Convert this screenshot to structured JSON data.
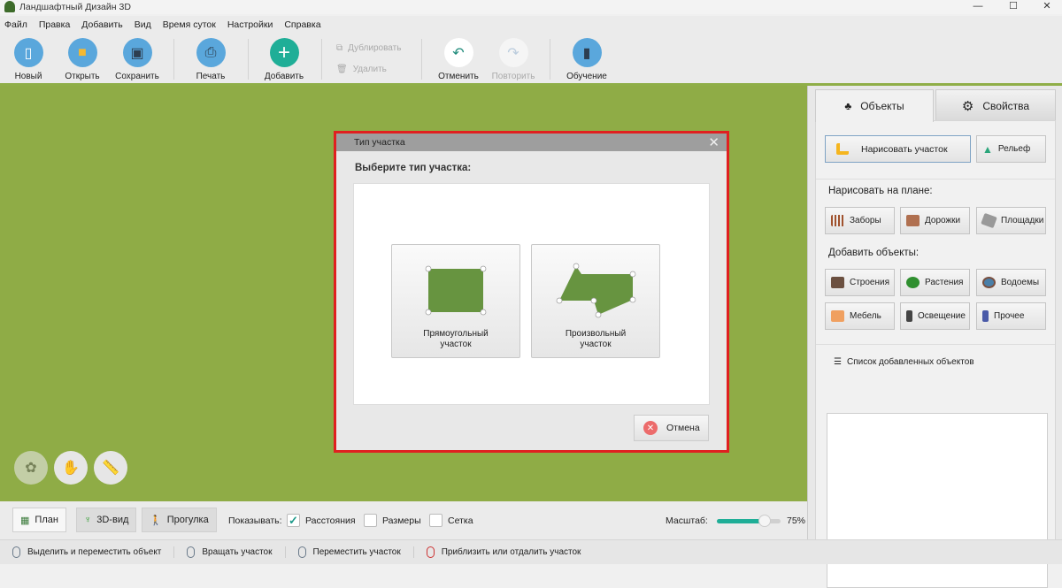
{
  "window": {
    "title": "Ландшафтный Дизайн 3D",
    "minimize": "—",
    "maximize": "☐",
    "close": "✕"
  },
  "menu": [
    "Файл",
    "Правка",
    "Добавить",
    "Вид",
    "Время суток",
    "Настройки",
    "Справка"
  ],
  "toolbar": {
    "new": "Новый",
    "open": "Открыть",
    "save": "Сохранить",
    "print": "Печать",
    "add": "Добавить",
    "duplicate": "Дублировать",
    "delete": "Удалить",
    "undo": "Отменить",
    "redo": "Повторить",
    "tutorial": "Обучение"
  },
  "dialog": {
    "title": "Тип участка",
    "prompt": "Выберите тип участка:",
    "rect_line1": "Прямоугольный",
    "rect_line2": "участок",
    "free_line1": "Произвольный",
    "free_line2": "участок",
    "cancel": "Отмена",
    "highlight_color": "#e02020"
  },
  "panel": {
    "tab_objects": "Объекты",
    "tab_properties": "Свойства",
    "draw_plot": "Нарисовать участок",
    "relief": "Рельеф",
    "draw_on_plan": "Нарисовать на плане:",
    "fences": "Заборы",
    "paths": "Дорожки",
    "areas": "Площадки",
    "add_objects": "Добавить объекты:",
    "buildings": "Строения",
    "plants": "Растения",
    "ponds": "Водоемы",
    "furniture": "Мебель",
    "lighting": "Освещение",
    "other": "Прочее",
    "object_list": "Список добавленных объектов"
  },
  "bottom": {
    "plan": "План",
    "view3d": "3D-вид",
    "walk": "Прогулка",
    "show": "Показывать:",
    "distances": "Расстояния",
    "distances_checked": true,
    "sizes": "Размеры",
    "sizes_checked": false,
    "grid": "Сетка",
    "grid_checked": false,
    "zoom_label": "Масштаб:",
    "zoom_value": "75%",
    "zoom_fraction": 0.75
  },
  "status": [
    "Выделить и переместить объект",
    "Вращать участок",
    "Переместить участок",
    "Приблизить или отдалить участок"
  ],
  "colors": {
    "lawn": "#8fac46",
    "accent": "#1e9a8a"
  }
}
